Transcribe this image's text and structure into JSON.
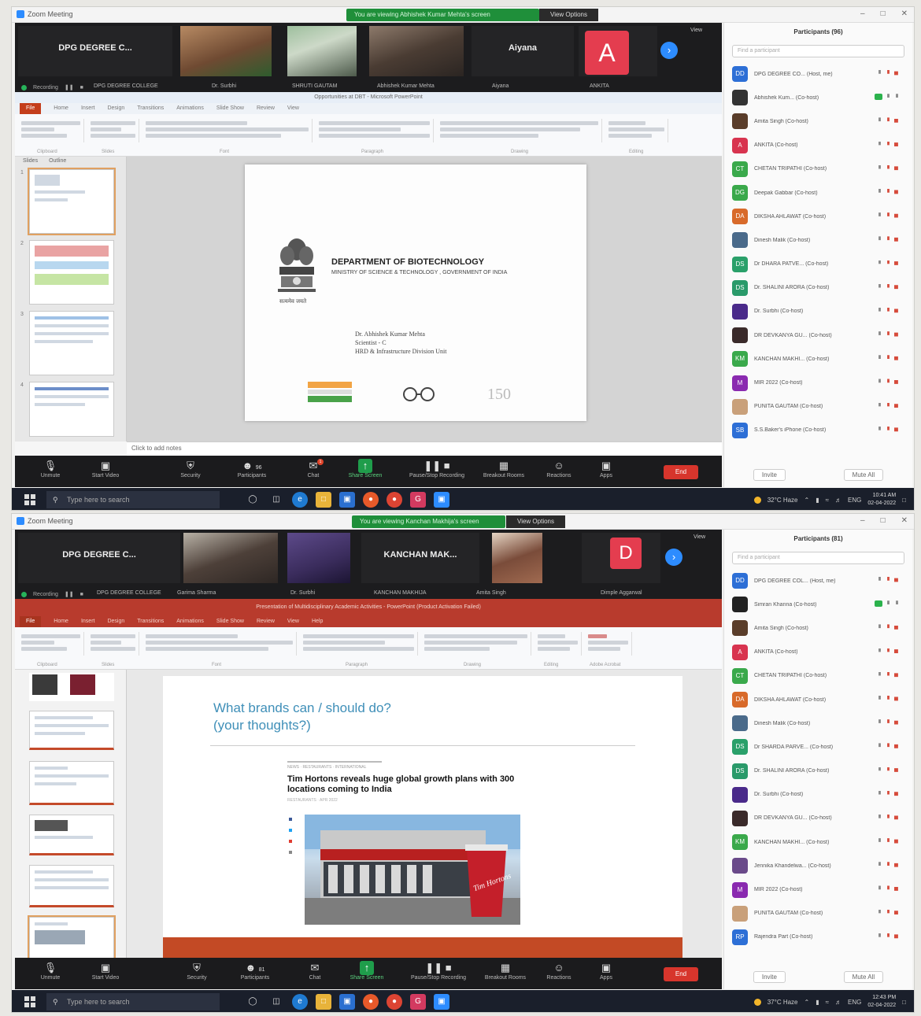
{
  "screenshots": [
    {
      "window_title": "Zoom Meeting",
      "recording_banner": "You are viewing Abhishek Kumar Mehta's screen",
      "view_options": "View Options",
      "video_strip": {
        "tiles": [
          {
            "big_name": "DPG DEGREE C...",
            "label": "DPG DEGREE COLLEGE"
          },
          {
            "label": "Dr. Surbhi"
          },
          {
            "label": "SHRUTI GAUTAM"
          },
          {
            "label": "Abhishek Kumar Mehta"
          },
          {
            "big_name": "Aiyana",
            "label": "Aiyana"
          },
          {
            "avatar_letter": "A",
            "label": "ANKITA"
          }
        ],
        "view_label": "View",
        "recording_label": "Recording"
      },
      "ppt": {
        "title": "Opportunities at DBT - Microsoft PowerPoint",
        "tabs": [
          "File",
          "Home",
          "Insert",
          "Design",
          "Transitions",
          "Animations",
          "Slide Show",
          "Review",
          "View"
        ],
        "groups": [
          "Clipboard",
          "Slides",
          "Font",
          "Paragraph",
          "Drawing",
          "Editing"
        ],
        "pane_tabs": [
          "Slides",
          "Outline"
        ],
        "slide": {
          "department": "DEPARTMENT OF BIOTECHNOLOGY",
          "ministry": "MINISTRY OF SCIENCE & TECHNOLOGY , GOVERNMENT OF INDIA",
          "emblem_motto": "सत्यमेव जयते",
          "presenter_name": "Dr. Abhishek Kumar Mehta",
          "presenter_title": "Scientist - C",
          "presenter_unit": "HRD & Infrastructure Division Unit"
        },
        "notes_placeholder": "Click to add notes"
      },
      "controls": [
        "Unmute",
        "Start Video",
        "Security",
        "Participants",
        "Chat",
        "Share Screen",
        "Pause/Stop Recording",
        "Breakout Rooms",
        "Reactions",
        "Apps"
      ],
      "participant_count": "96",
      "chat_badge": "1",
      "end_label": "End",
      "panel": {
        "title": "Participants (96)",
        "search_placeholder": "Find a participant",
        "participants": [
          {
            "initials": "DD",
            "color": "#2d6fd6",
            "name": "DPG DEGREE CO... (Host, me)"
          },
          {
            "initials": "",
            "color": "#333333",
            "name": "Abhishek Kum... (Co-host)"
          },
          {
            "initials": "",
            "color": "#5a3d2a",
            "name": "Amita Singh (Co-host)"
          },
          {
            "initials": "A",
            "color": "#d8344f",
            "name": "ANKITA (Co-host)"
          },
          {
            "initials": "CT",
            "color": "#3aa94b",
            "name": "CHETAN TRIPATHI (Co-host)"
          },
          {
            "initials": "DG",
            "color": "#3aa94b",
            "name": "Deepak Gabbar (Co-host)"
          },
          {
            "initials": "DA",
            "color": "#d86a2a",
            "name": "DIKSHA AHLAWAT (Co-host)"
          },
          {
            "initials": "",
            "color": "#4a6a8a",
            "name": "Dinesh Malik (Co-host)"
          },
          {
            "initials": "DS",
            "color": "#2aa06a",
            "name": "Dr DHARA PATVE... (Co-host)"
          },
          {
            "initials": "DS",
            "color": "#2a9a6a",
            "name": "Dr. SHALINI ARORA (Co-host)"
          },
          {
            "initials": "",
            "color": "#4a2a8a",
            "name": "Dr. Surbhi (Co-host)"
          },
          {
            "initials": "",
            "color": "#3a2a2a",
            "name": "DR DEVKANYA GU... (Co-host)"
          },
          {
            "initials": "KM",
            "color": "#3aa94b",
            "name": "KANCHAN MAKHI... (Co-host)"
          },
          {
            "initials": "M",
            "color": "#8a2ab0",
            "name": "MIR 2022 (Co-host)"
          },
          {
            "initials": "",
            "color": "#c9a07a",
            "name": "PUNITA GAUTAM (Co-host)"
          },
          {
            "initials": "SB",
            "color": "#2d6fd6",
            "name": "S.S.Baker's iPhone (Co-host)"
          }
        ],
        "footer": [
          "Invite",
          "Mute All"
        ]
      },
      "taskbar": {
        "search_placeholder": "Type here to search",
        "weather": "32°C Haze",
        "lang": "ENG",
        "time": "10:41 AM",
        "date": "02-04-2022"
      }
    },
    {
      "window_title": "Zoom Meeting",
      "recording_banner": "You are viewing Kanchan Makhija's screen",
      "view_options": "View Options",
      "video_strip": {
        "tiles": [
          {
            "big_name": "DPG DEGREE C...",
            "label": "DPG DEGREE COLLEGE"
          },
          {
            "label": "Garima Sharma"
          },
          {
            "label": "Dr. Surbhi"
          },
          {
            "big_name": "KANCHAN MAK...",
            "label": "KANCHAN MAKHIJA"
          },
          {
            "label": "Amita Singh"
          },
          {
            "avatar_letter": "D",
            "label": "Dimple Aggarwal"
          }
        ],
        "view_label": "View",
        "recording_label": "Recording"
      },
      "ppt": {
        "title": "Presentation of Multidisciplinary Academic Activities - PowerPoint (Product Activation Failed)",
        "tabs": [
          "File",
          "Home",
          "Insert",
          "Design",
          "Transitions",
          "Animations",
          "Slide Show",
          "Review",
          "View",
          "Help"
        ],
        "groups": [
          "Clipboard",
          "Slides",
          "Font",
          "Paragraph",
          "Drawing",
          "Editing",
          "Adobe Acrobat"
        ],
        "slide": {
          "title_line1": "What brands can / should do?",
          "title_line2": "(your thoughts?)",
          "article_kicker": "NEWS · RESTAURANTS · INTERNATIONAL",
          "article_headline": "Tim Hortons reveals huge global growth plans with 300 locations coming to India",
          "article_byline": "RESTAURANTS · APR 2022",
          "cup_text": "Tim Hortons"
        }
      },
      "controls": [
        "Unmute",
        "Start Video",
        "Security",
        "Participants",
        "Chat",
        "Share Screen",
        "Pause/Stop Recording",
        "Breakout Rooms",
        "Reactions",
        "Apps"
      ],
      "participant_count": "81",
      "end_label": "End",
      "panel": {
        "title": "Participants (81)",
        "search_placeholder": "Find a participant",
        "participants": [
          {
            "initials": "DD",
            "color": "#2d6fd6",
            "name": "DPG DEGREE COL... (Host, me)"
          },
          {
            "initials": "",
            "color": "#222222",
            "name": "Simran Khanna (Co-host)"
          },
          {
            "initials": "",
            "color": "#5a3d2a",
            "name": "Amita Singh (Co-host)"
          },
          {
            "initials": "A",
            "color": "#d8344f",
            "name": "ANKITA (Co-host)"
          },
          {
            "initials": "CT",
            "color": "#3aa94b",
            "name": "CHETAN TRIPATHI (Co-host)"
          },
          {
            "initials": "DA",
            "color": "#d86a2a",
            "name": "DIKSHA AHLAWAT (Co-host)"
          },
          {
            "initials": "",
            "color": "#4a6a8a",
            "name": "Dinesh Malik (Co-host)"
          },
          {
            "initials": "DS",
            "color": "#2aa06a",
            "name": "Dr SHARDA PARVE... (Co-host)"
          },
          {
            "initials": "DS",
            "color": "#2a9a6a",
            "name": "Dr. SHALINI ARORA (Co-host)"
          },
          {
            "initials": "",
            "color": "#4a2a8a",
            "name": "Dr. Surbhi (Co-host)"
          },
          {
            "initials": "",
            "color": "#3a2a2a",
            "name": "DR DEVKANYA GU... (Co-host)"
          },
          {
            "initials": "KM",
            "color": "#3aa94b",
            "name": "KANCHAN MAKHI... (Co-host)"
          },
          {
            "initials": "",
            "color": "#6a4a8a",
            "name": "Jennika Khandelwa... (Co-host)"
          },
          {
            "initials": "M",
            "color": "#8a2ab0",
            "name": "MIR 2022 (Co-host)"
          },
          {
            "initials": "",
            "color": "#c9a07a",
            "name": "PUNITA GAUTAM (Co-host)"
          },
          {
            "initials": "RP",
            "color": "#2d6fd6",
            "name": "Rajendra Part (Co-host)"
          }
        ],
        "footer": [
          "Invite",
          "Mute All"
        ]
      },
      "taskbar": {
        "search_placeholder": "Type here to search",
        "weather": "37°C Haze",
        "lang": "ENG",
        "time": "12:43 PM",
        "date": "02-04-2022"
      }
    }
  ]
}
